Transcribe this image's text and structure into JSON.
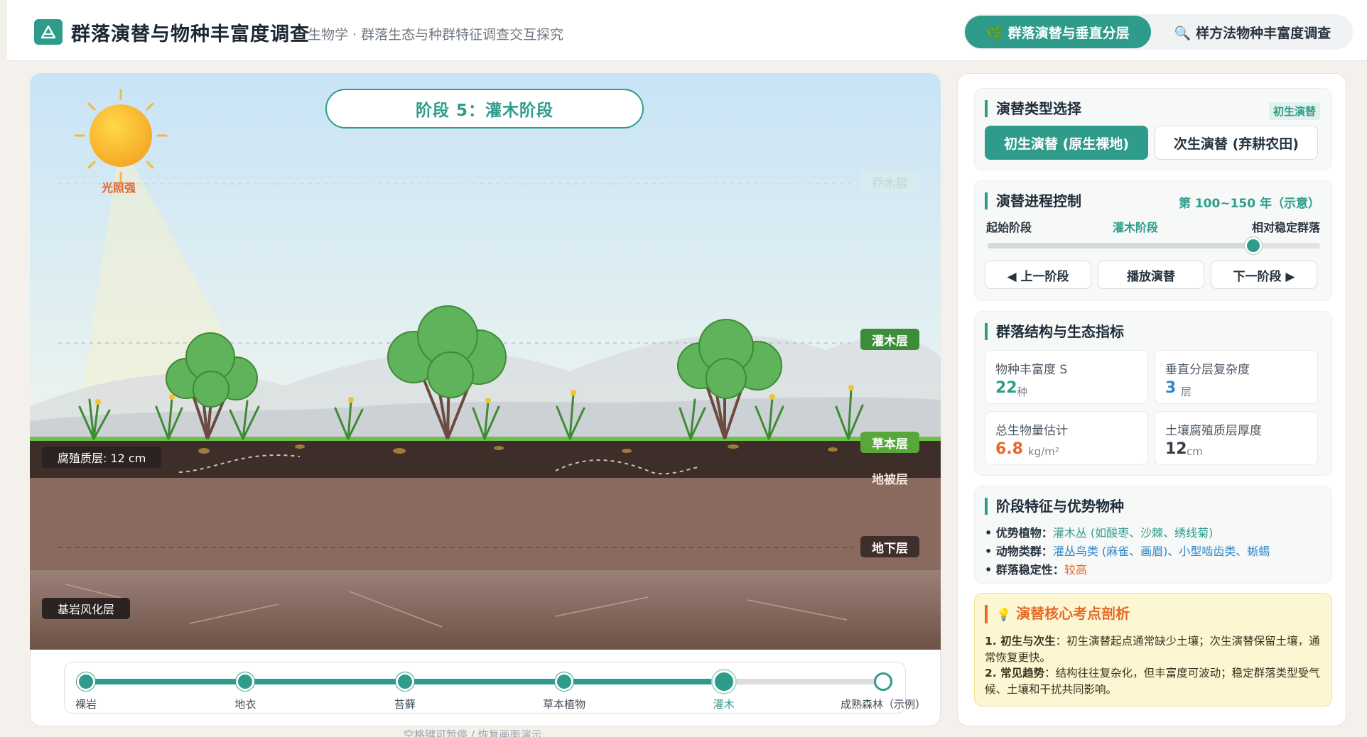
{
  "header": {
    "title": "群落演替与物种丰富度调查",
    "subtitle": "生物学 · 群落生态与种群特征调查交互探究",
    "tabs": [
      {
        "icon": "seedling-icon",
        "label": "🌿 群落演替与垂直分层"
      },
      {
        "icon": "magnifier-icon",
        "label": "🔍 样方法物种丰富度调查"
      }
    ]
  },
  "scene": {
    "stage_title": "阶段 5：灌木阶段",
    "sun_label": "光照强",
    "layers": {
      "tree": "乔木层",
      "shrub": "灌木层",
      "herb": "草本层",
      "ground": "地被层",
      "underground": "地下层"
    },
    "humus_label": "腐殖质层: 12 cm",
    "bedrock_label": "基岩风化层"
  },
  "timeline": {
    "stages": [
      "裸岩",
      "地衣",
      "苔藓",
      "草本植物",
      "灌木",
      "成熟森林（示例）"
    ],
    "current_index": 4,
    "hint": "空格键可暂停 / 恢复画面演示"
  },
  "panel": {
    "succession_type": {
      "title": "演替类型选择",
      "badge": "初生演替",
      "options": [
        "初生演替 (原生裸地)",
        "次生演替 (弃耕农田)"
      ]
    },
    "progress": {
      "title": "演替进程控制",
      "years": "第 100~150 年（示意）",
      "start_label": "起始阶段",
      "current_label": "灌木阶段",
      "end_label": "相对稳定群落",
      "slider_value": 0.8,
      "buttons": [
        "◀ 上一阶段",
        "播放演替",
        "下一阶段 ▶"
      ]
    },
    "metrics": {
      "title": "群落结构与生态指标",
      "items": [
        {
          "label": "物种丰富度 S",
          "value": "22",
          "unit": "种",
          "color": "#2f9c8b"
        },
        {
          "label": "垂直分层复杂度",
          "value": "3",
          "unit": "层",
          "color": "#2f86c9"
        },
        {
          "label": "总生物量估计",
          "value": "6.8",
          "unit": "kg/m²",
          "color": "#e56a2a"
        },
        {
          "label": "土壤腐殖质层厚度",
          "value": "12",
          "unit": "cm",
          "color": "#3a3f45"
        }
      ]
    },
    "features": {
      "title": "阶段特征与优势物种",
      "lines": [
        {
          "key": "• 优势植物：",
          "value": "灌木丛 (如酸枣、沙棘、绣线菊)",
          "color": "#2f9c8b"
        },
        {
          "key": "• 动物类群：",
          "value": "灌丛鸟类 (麻雀、画眉)、小型啮齿类、蜥蜴",
          "color": "#2f86c9"
        },
        {
          "key": "• 群落稳定性：",
          "value": "较高",
          "color": "#e56a2a"
        }
      ]
    },
    "analysis": {
      "title": "演替核心考点剖析",
      "icon": "bulb-icon",
      "point1_head": "1. 初生与次生",
      "point1_body": "：初生演替起点通常缺少土壤；次生演替保留土壤，通常恢复更快。",
      "point2_head": "2. 常见趋势",
      "point2_body": "：结构往往复杂化，但丰富度可波动；稳定群落类型受气候、土壤和干扰共同影响。"
    }
  },
  "colors": {
    "accent": "#2f9c8b",
    "orange": "#e56a2a",
    "blue": "#2f86c9"
  }
}
